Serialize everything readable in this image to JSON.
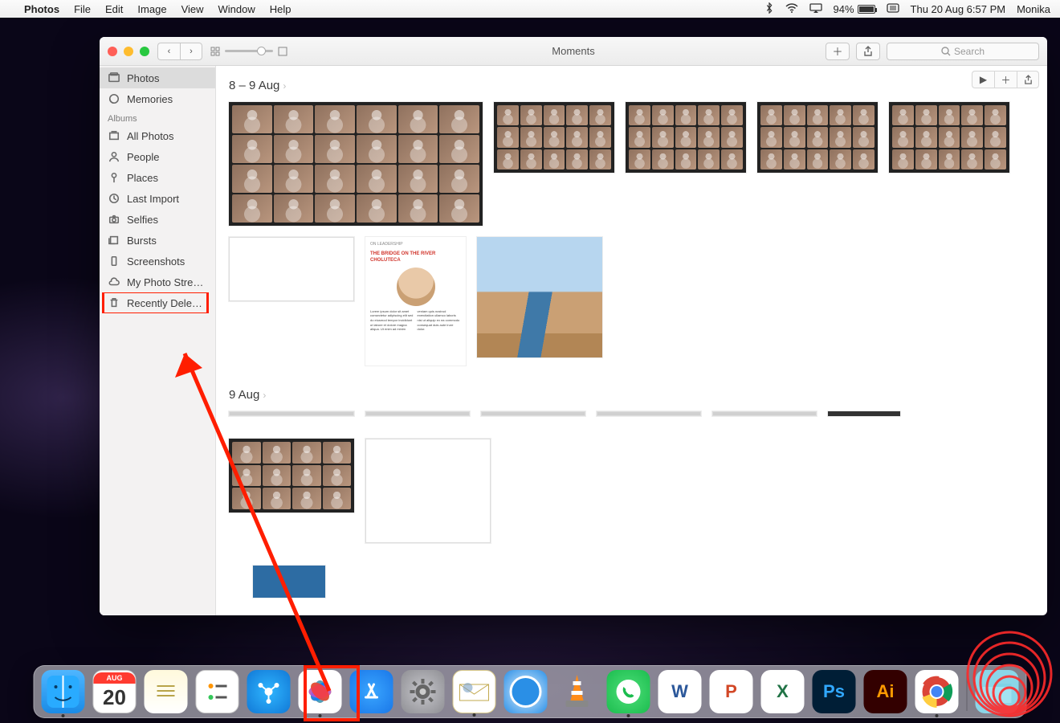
{
  "menubar": {
    "app": "Photos",
    "items": [
      "File",
      "Edit",
      "Image",
      "View",
      "Window",
      "Help"
    ],
    "battery": "94%",
    "datetime": "Thu 20 Aug  6:57 PM",
    "user": "Monika"
  },
  "window": {
    "title": "Moments",
    "search_placeholder": "Search"
  },
  "sidebar": {
    "library": [
      {
        "label": "Photos",
        "icon": "photos"
      },
      {
        "label": "Memories",
        "icon": "memories"
      }
    ],
    "section_label": "Albums",
    "albums": [
      {
        "label": "All Photos",
        "icon": "stack"
      },
      {
        "label": "People",
        "icon": "person"
      },
      {
        "label": "Places",
        "icon": "pin"
      },
      {
        "label": "Last Import",
        "icon": "clock"
      },
      {
        "label": "Selfies",
        "icon": "camera"
      },
      {
        "label": "Bursts",
        "icon": "stack"
      },
      {
        "label": "Screenshots",
        "icon": "device"
      },
      {
        "label": "My Photo Stre…",
        "icon": "cloud"
      },
      {
        "label": "Recently Dele…",
        "icon": "trash"
      }
    ]
  },
  "moments": {
    "m1_title": "8 – 9 Aug",
    "m2_title": "9 Aug",
    "doc_headline": "THE BRIDGE ON THE RIVER CHOLUTECA"
  },
  "dock": {
    "cal_month": "AUG",
    "cal_day": "20",
    "items": [
      "finder",
      "calendar",
      "notes",
      "reminders",
      "shareit",
      "photos",
      "appstore",
      "settings",
      "mail",
      "safari",
      "vlc",
      "whatsapp",
      "word",
      "powerpoint",
      "excel",
      "photoshop",
      "illustrator",
      "chrome"
    ],
    "after_sep": [
      "downloads"
    ]
  },
  "annotations": {
    "highlight_sidebar": "Recently Deleted",
    "highlight_dock": "Photos"
  }
}
